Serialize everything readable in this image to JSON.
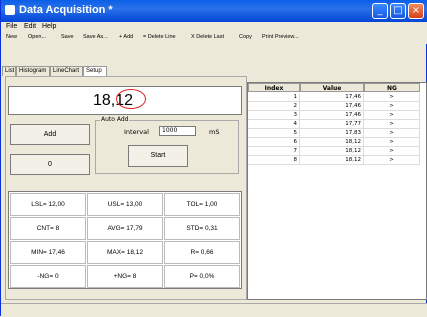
{
  "window": {
    "title": "Data Acquisition *",
    "accent": "#0a5fe8"
  },
  "menu": {
    "items": [
      "File",
      "Edit",
      "Help"
    ]
  },
  "toolbar": {
    "items": [
      "New",
      "Open...",
      "Save",
      "Save As...",
      "+ Add",
      "= Delete Line",
      "X Delete Last",
      "Copy",
      "Print Preview..."
    ]
  },
  "tabs": [
    "List",
    "Histogram",
    "LineChart",
    "Setup"
  ],
  "main": {
    "current_value": "18,12",
    "add_label": "Add",
    "zero_label": "0",
    "autoadd": {
      "label": "Auto Add",
      "interval_label": "Interval",
      "interval_value": "1000",
      "interval_unit": "mS",
      "start_label": "Start"
    }
  },
  "stats": [
    [
      "LSL= 12,00",
      "USL= 13,00",
      "TOL= 1,00"
    ],
    [
      "CNT= 8",
      "AVG= 17,79",
      "STD= 0,31"
    ],
    [
      "MIN= 17,46",
      "MAX= 18,12",
      "R= 0,66"
    ],
    [
      "-NG= 0",
      "+NG= 8",
      "P= 0,0%"
    ]
  ],
  "table": {
    "headers": [
      "Index",
      "Value",
      "NG"
    ],
    "rows": [
      [
        "1",
        "17,46",
        ">"
      ],
      [
        "2",
        "17,46",
        ">"
      ],
      [
        "3",
        "17,46",
        ">"
      ],
      [
        "4",
        "17,77",
        ">"
      ],
      [
        "5",
        "17,83",
        ">"
      ],
      [
        "6",
        "18,12",
        ">"
      ],
      [
        "7",
        "18,12",
        ">"
      ],
      [
        "8",
        "18,12",
        ">"
      ]
    ]
  }
}
